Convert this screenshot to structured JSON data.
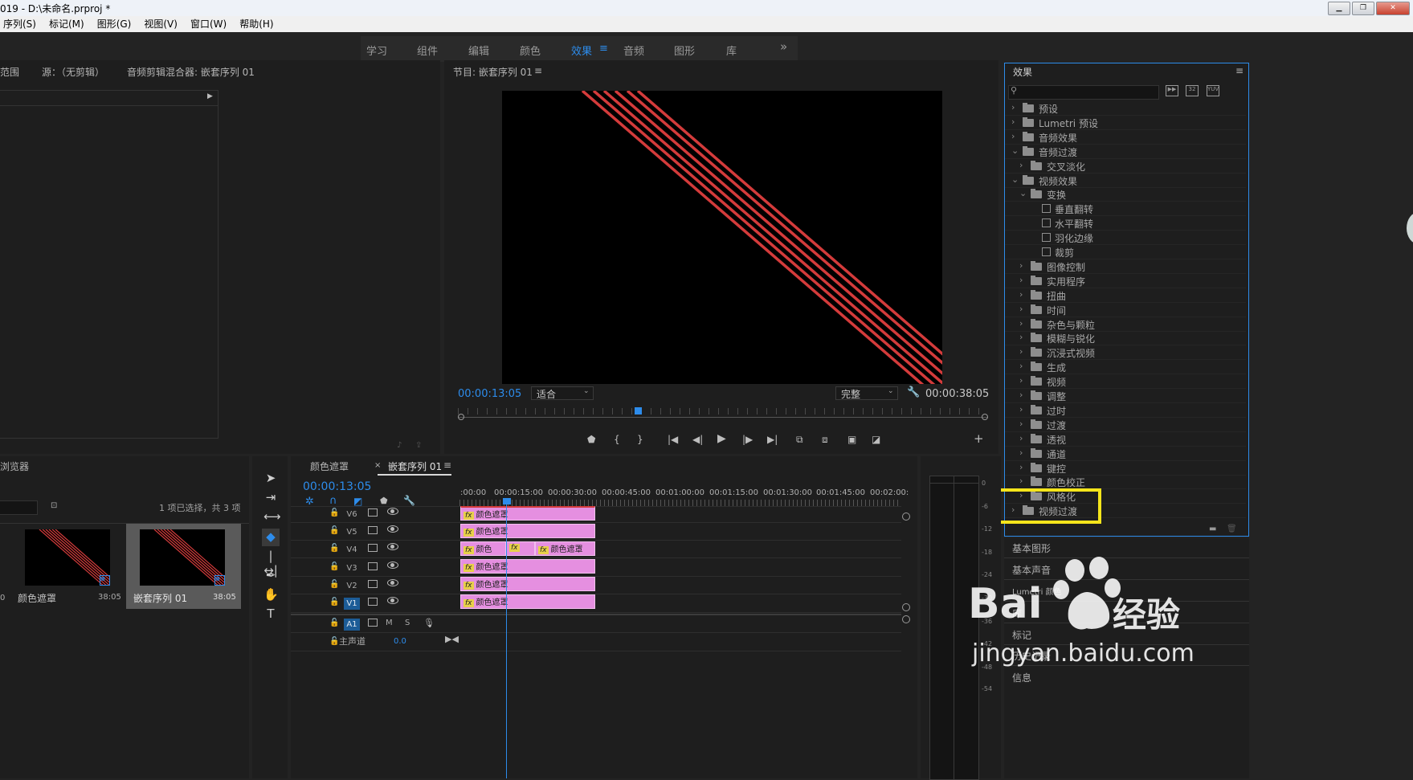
{
  "window": {
    "title": "019 - D:\\未命名.prproj *",
    "buttons": [
      "▁",
      "❐",
      "✕"
    ]
  },
  "menu": [
    "序列(S)",
    "标记(M)",
    "图形(G)",
    "视图(V)",
    "窗口(W)",
    "帮助(H)"
  ],
  "workspaces": {
    "tabs": [
      "学习",
      "组件",
      "编辑",
      "颜色",
      "效果",
      "音频",
      "图形",
      "库"
    ],
    "active": "效果",
    "menu_icon": "≡",
    "more": "»"
  },
  "source_panel": {
    "tabs": [
      "范围",
      "源：（无剪辑）",
      "音频剪辑混合器: 嵌套序列 01"
    ]
  },
  "program": {
    "title": "节目: 嵌套序列 01",
    "menu_icon": "≡",
    "timecode": "00:00:13:05",
    "fit": "适合",
    "quality": "完整",
    "duration": "00:00:38:05",
    "line_color": "#d43b3b"
  },
  "effects": {
    "title": "效果",
    "menu_icon": "≡",
    "tree": [
      {
        "label": "预设",
        "level": 0,
        "open": false,
        "type": "star-folder"
      },
      {
        "label": "Lumetri 预设",
        "level": 0,
        "open": false,
        "type": "star-folder"
      },
      {
        "label": "音频效果",
        "level": 0,
        "open": false,
        "type": "folder"
      },
      {
        "label": "音频过渡",
        "level": 0,
        "open": true,
        "type": "folder"
      },
      {
        "label": "交叉淡化",
        "level": 1,
        "open": false,
        "type": "folder"
      },
      {
        "label": "视频效果",
        "level": 0,
        "open": true,
        "type": "folder"
      },
      {
        "label": "变换",
        "level": 1,
        "open": true,
        "type": "folder"
      },
      {
        "label": "垂直翻转",
        "level": 2,
        "open": null,
        "type": "effect"
      },
      {
        "label": "水平翻转",
        "level": 2,
        "open": null,
        "type": "effect"
      },
      {
        "label": "羽化边缘",
        "level": 2,
        "open": null,
        "type": "effect"
      },
      {
        "label": "裁剪",
        "level": 2,
        "open": null,
        "type": "effect"
      },
      {
        "label": "图像控制",
        "level": 1,
        "open": false,
        "type": "folder"
      },
      {
        "label": "实用程序",
        "level": 1,
        "open": false,
        "type": "folder"
      },
      {
        "label": "扭曲",
        "level": 1,
        "open": false,
        "type": "folder"
      },
      {
        "label": "时间",
        "level": 1,
        "open": false,
        "type": "folder"
      },
      {
        "label": "杂色与颗粒",
        "level": 1,
        "open": false,
        "type": "folder"
      },
      {
        "label": "模糊与锐化",
        "level": 1,
        "open": false,
        "type": "folder"
      },
      {
        "label": "沉浸式视频",
        "level": 1,
        "open": false,
        "type": "folder"
      },
      {
        "label": "生成",
        "level": 1,
        "open": false,
        "type": "folder"
      },
      {
        "label": "视频",
        "level": 1,
        "open": false,
        "type": "folder"
      },
      {
        "label": "调整",
        "level": 1,
        "open": false,
        "type": "folder"
      },
      {
        "label": "过时",
        "level": 1,
        "open": false,
        "type": "folder"
      },
      {
        "label": "过渡",
        "level": 1,
        "open": false,
        "type": "folder"
      },
      {
        "label": "透视",
        "level": 1,
        "open": false,
        "type": "folder"
      },
      {
        "label": "通道",
        "level": 1,
        "open": false,
        "type": "folder"
      },
      {
        "label": "键控",
        "level": 1,
        "open": false,
        "type": "folder"
      },
      {
        "label": "颜色校正",
        "level": 1,
        "open": false,
        "type": "folder"
      },
      {
        "label": "风格化",
        "level": 1,
        "open": false,
        "type": "folder"
      },
      {
        "label": "视频过渡",
        "level": 0,
        "open": false,
        "type": "folder"
      }
    ],
    "highlight_color": "#f5e51b"
  },
  "side_panels": [
    "基本图形",
    "基本声音",
    "Lumetri 颜色",
    "库",
    "标记",
    "历史记录",
    "信息"
  ],
  "project": {
    "title": "浏览器",
    "selection": "1 项已选择，共 3 项",
    "items": [
      {
        "name": "颜色遮罩",
        "duration": "38:05",
        "prefix": "0"
      },
      {
        "name": "嵌套序列 01",
        "duration": "38:05",
        "prefix": ""
      }
    ]
  },
  "timeline": {
    "tabs": [
      "颜色遮罩",
      "嵌套序列 01"
    ],
    "close_icon": "×",
    "menu_icon": "≡",
    "timecode": "00:00:13:05",
    "ruler": [
      ":00:00",
      "00:00:15:00",
      "00:00:30:00",
      "00:00:45:00",
      "00:01:00:00",
      "00:01:15:00",
      "00:01:30:00",
      "00:01:45:00",
      "00:02:00:"
    ],
    "video_tracks": [
      "V6",
      "V5",
      "V4",
      "V3",
      "V2",
      "V1"
    ],
    "audio_track": "A1",
    "audio_buttons": [
      "M",
      "S"
    ],
    "master": {
      "label": "主声道",
      "value": "0.0"
    },
    "clip_label": "颜色遮罩",
    "clip_short": "颜色",
    "fx": "fx",
    "clip_color": "#e58fe0"
  },
  "meter": {
    "labels": [
      "0",
      "-6",
      "-12",
      "-18",
      "-24",
      "-30",
      "-36",
      "-42",
      "-48",
      "-54"
    ]
  },
  "watermark": {
    "brand": "Bai",
    "brand_cn": "经验",
    "url": "jingyan.baidu.com"
  }
}
